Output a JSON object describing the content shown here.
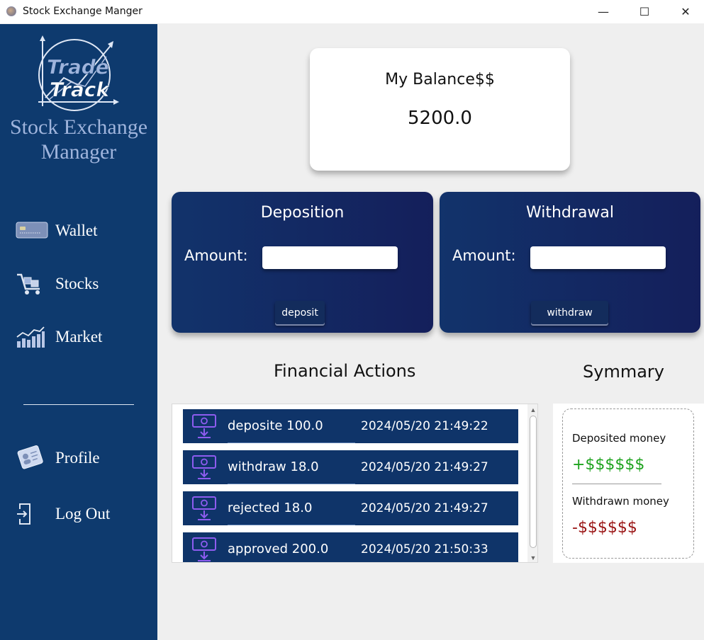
{
  "window": {
    "title": "Stock Exchange Manger",
    "minimize": "—",
    "maximize": "☐",
    "close": "✕"
  },
  "sidebar": {
    "logo_text_top": "Trade",
    "logo_text_bottom": "Track",
    "brand_line1": "Stock Exchange",
    "brand_line2": "Manager",
    "items": [
      {
        "label": "Wallet",
        "icon": "wallet-card-icon"
      },
      {
        "label": "Stocks",
        "icon": "stocks-cart-icon"
      },
      {
        "label": "Market",
        "icon": "market-chart-icon"
      },
      {
        "label": "Profile",
        "icon": "profile-id-icon"
      },
      {
        "label": "Log Out",
        "icon": "logout-icon"
      }
    ]
  },
  "balance": {
    "title": "My Balance$$",
    "value": "5200.0"
  },
  "deposit": {
    "title": "Deposition",
    "amount_label": "Amount:",
    "amount_value": "",
    "button": "deposit"
  },
  "withdraw": {
    "title": "Withdrawal",
    "amount_label": "Amount:",
    "amount_value": "",
    "button": "withdraw"
  },
  "financial_actions": {
    "title": "Financial Actions",
    "rows": [
      {
        "label": "deposite 100.0",
        "date": "2024/05/20 21:49:22",
        "icon": "money-transfer-icon"
      },
      {
        "label": "withdraw 18.0",
        "date": "2024/05/20 21:49:27",
        "icon": "money-transfer-icon"
      },
      {
        "label": "rejected 18.0",
        "date": "2024/05/20 21:49:27",
        "icon": "money-transfer-icon"
      },
      {
        "label": "approved 200.0",
        "date": "2024/05/20 21:50:33",
        "icon": "money-transfer-icon"
      }
    ]
  },
  "summary": {
    "title": "Symmary",
    "deposited_label": "Deposited money",
    "deposited_value": "+$$$$$$",
    "withdrawn_label": "Withdrawn money",
    "withdrawn_value": "-$$$$$$"
  },
  "colors": {
    "sidebar": "#0e3a6e",
    "card_gradient_start": "#12336b",
    "card_gradient_end": "#141f5b",
    "deposit_green": "#1ea31e",
    "withdraw_red": "#9a1414"
  }
}
